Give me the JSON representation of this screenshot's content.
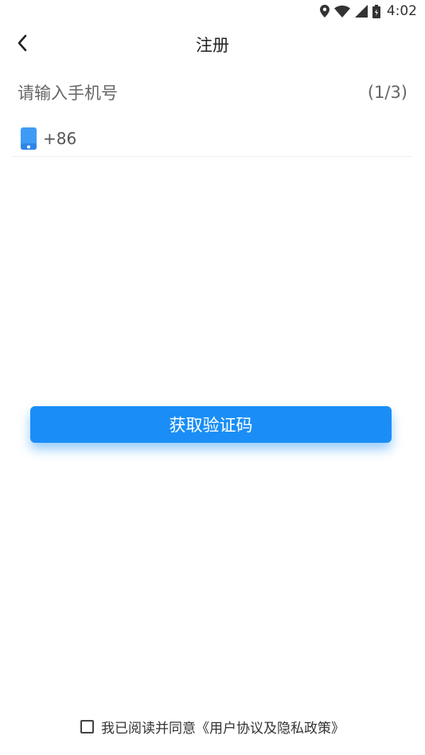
{
  "status_bar": {
    "time": "4:02",
    "icons": [
      "location-icon",
      "wifi-icon",
      "signal-icon",
      "battery-icon"
    ]
  },
  "header": {
    "back_icon": "chevron-left-icon",
    "title": "注册"
  },
  "form": {
    "prompt": "请输入手机号",
    "step": "(1/3)",
    "phone_icon": "phone-icon",
    "country_code": "+86",
    "phone_value": "",
    "phone_placeholder": ""
  },
  "actions": {
    "get_code_label": "获取验证码"
  },
  "agreement": {
    "checked": false,
    "text": "我已阅读并同意《用户协议及隐私政策》"
  },
  "colors": {
    "accent": "#1a8ef6",
    "phone_icon": "#3d9bf5"
  }
}
